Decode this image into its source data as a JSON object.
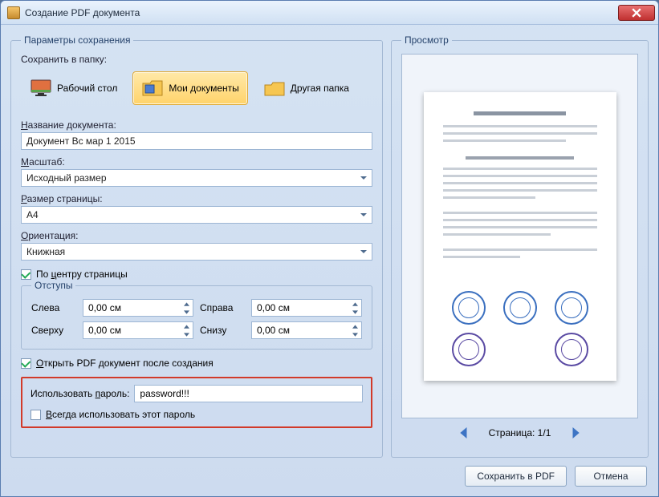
{
  "window": {
    "title": "Создание PDF документа"
  },
  "params": {
    "legend": "Параметры сохранения",
    "save_to_label": "Сохранить в папку:",
    "folders": {
      "desktop": "Рабочий стол",
      "my_documents": "Мои документы",
      "other": "Другая папка"
    },
    "doc_name_label": "Название документа:",
    "doc_name_value": "Документ Вс мар 1 2015",
    "scale_label": "Масштаб:",
    "scale_value": "Исходный размер",
    "page_size_label": "Размер страницы:",
    "page_size_value": "A4",
    "orientation_label": "Ориентация:",
    "orientation_value": "Книжная",
    "center_label": "По центру страницы",
    "center_checked": true,
    "indents": {
      "legend": "Отступы",
      "left_label": "Слева",
      "left_value": "0,00 см",
      "right_label": "Справа",
      "right_value": "0,00 см",
      "top_label": "Сверху",
      "top_value": "0,00 см",
      "bottom_label": "Снизу",
      "bottom_value": "0,00 см"
    },
    "open_after_label": "Открыть PDF документ после создания",
    "open_after_checked": true,
    "password": {
      "use_label": "Использовать пароль:",
      "value": "password!!!",
      "always_label": "Всегда использовать этот пароль",
      "always_checked": false
    }
  },
  "preview": {
    "legend": "Просмотр",
    "page_indicator": "Страница: 1/1"
  },
  "footer": {
    "save": "Сохранить в PDF",
    "cancel": "Отмена"
  }
}
